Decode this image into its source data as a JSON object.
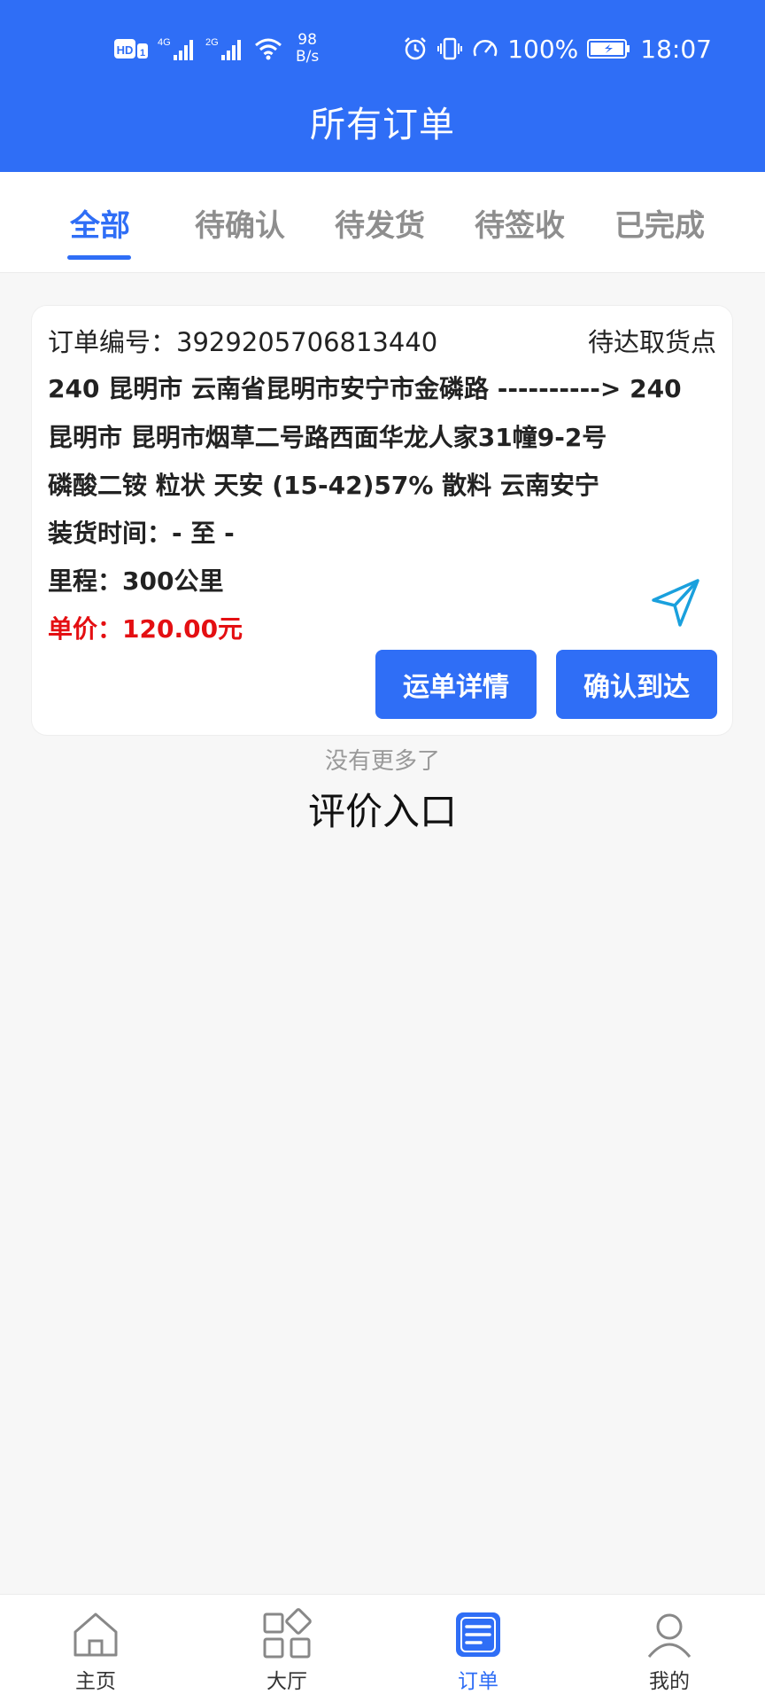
{
  "status_bar": {
    "hd_badge": "HD",
    "sim_slot": "1",
    "net1": "4G",
    "net2": "2G",
    "speed_value": "98",
    "speed_unit": "B/s",
    "battery": "100%",
    "time": "18:07"
  },
  "header": {
    "title": "所有订单"
  },
  "tabs": [
    {
      "label": "全部",
      "active": true
    },
    {
      "label": "待确认",
      "active": false
    },
    {
      "label": "待发货",
      "active": false
    },
    {
      "label": "待签收",
      "active": false
    },
    {
      "label": "已完成",
      "active": false
    }
  ],
  "order": {
    "order_no_label": "订单编号：",
    "order_no": "3929205706813440",
    "status": "待达取货点",
    "route_line1": "240 昆明市 云南省昆明市安宁市金磷路  ---------->  240",
    "route_line2": "昆明市 昆明市烟草二号路西面华龙人家31幢9-2号",
    "goods": "磷酸二铵 粒状 天安 (15-42)57% 散料 云南安宁",
    "load_time": "装货时间：- 至 -",
    "distance": "里程：300公里",
    "price": "单价：120.00元",
    "btn_detail": "运单详情",
    "btn_confirm": "确认到达"
  },
  "list_footer": {
    "no_more": "没有更多了",
    "review_entry": "评价入口"
  },
  "bottom_nav": [
    {
      "label": "主页",
      "icon": "home-icon",
      "active": false
    },
    {
      "label": "大厅",
      "icon": "grid-icon",
      "active": false
    },
    {
      "label": "订单",
      "icon": "order-list-icon",
      "active": true
    },
    {
      "label": "我的",
      "icon": "user-icon",
      "active": false
    }
  ],
  "colors": {
    "primary": "#2f6ef6",
    "price_red": "#e40f12",
    "inactive_tab": "#8e8e8e",
    "send_icon": "#1aa0dd"
  }
}
